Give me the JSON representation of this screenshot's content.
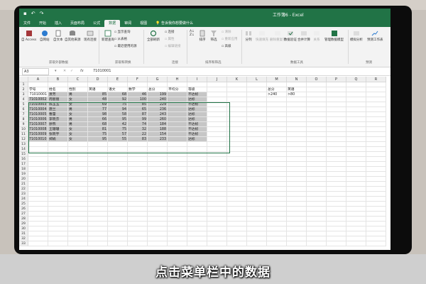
{
  "window": {
    "title": "工作簿6 - Excel"
  },
  "tabs": [
    "文件",
    "开始",
    "插入",
    "页面布局",
    "公式",
    "数据",
    "审阅",
    "视图"
  ],
  "active_tab": "数据",
  "tell_me": "告诉我你想要做什么",
  "ribbon": {
    "access": "自 Access",
    "website": "自网站",
    "text": "自文本",
    "other_sources": "自其他来源",
    "existing_connections": "现有连接",
    "group_external": "获取外部数据",
    "new_query": "新建查询",
    "show_queries": "显示查询",
    "from_table": "从表格",
    "recent_sources": "最近使用的源",
    "group_transform": "获取和转换",
    "refresh_all": "全部刷新",
    "connections": "连接",
    "properties": "属性",
    "edit_links": "编辑链接",
    "group_connections": "连接",
    "sort": "排序",
    "filter": "筛选",
    "clear": "清除",
    "reapply": "重新应用",
    "advanced": "高级",
    "group_sort_filter": "排序和筛选",
    "split": "分列",
    "flash_fill": "快速填充",
    "remove_duplicates": "删除重复项",
    "data_validation": "数据验证",
    "consolidate": "合并计算",
    "relationships": "关系",
    "manage_model": "管理数据模型",
    "group_data_tools": "数据工具",
    "what_if": "模拟分析",
    "forecast_sheet": "预测工作表",
    "group_forecast": "预测"
  },
  "formula_bar": {
    "name_box": "A3",
    "fx": "fx",
    "value": "71010001"
  },
  "columns": [
    "A",
    "B",
    "C",
    "D",
    "E",
    "F",
    "G",
    "H",
    "I",
    "J",
    "K",
    "L",
    "M",
    "N",
    "O",
    "P",
    "Q",
    "R"
  ],
  "headers": [
    "学号",
    "姓名",
    "性别",
    "英语",
    "语文",
    "数学",
    "总分",
    "平均分",
    "等级"
  ],
  "rows": [
    [
      "71010001",
      "萧芳",
      "男",
      "85",
      "68",
      "46",
      "199",
      "",
      "不达标"
    ],
    [
      "71010002",
      "周丽丽",
      "女",
      "48",
      "92",
      "100",
      "240",
      "",
      "达标"
    ],
    [
      "71010003",
      "陈玉玉",
      "女",
      "69",
      "75",
      "85",
      "229",
      "",
      "不达标"
    ],
    [
      "71010004",
      "唐兰",
      "男",
      "77",
      "94",
      "65",
      "236",
      "",
      "达标"
    ],
    [
      "71010005",
      "曹蕾",
      "女",
      "98",
      "58",
      "87",
      "243",
      "",
      "达标"
    ],
    [
      "71010006",
      "李晓芬",
      "男",
      "66",
      "95",
      "99",
      "260",
      "",
      "达标"
    ],
    [
      "71010007",
      "廖燕",
      "男",
      "68",
      "42",
      "74",
      "184",
      "",
      "不达标"
    ],
    [
      "71010008",
      "王珊珊",
      "女",
      "81",
      "75",
      "32",
      "188",
      "",
      "不达标"
    ],
    [
      "71010009",
      "张晓宇",
      "女",
      "75",
      "57",
      "22",
      "154",
      "",
      "不达标"
    ],
    [
      "71010010",
      "郑娟",
      "女",
      "95",
      "55",
      "83",
      "233",
      "",
      "达标"
    ]
  ],
  "criteria": {
    "h1": "总分",
    "h2": "英语",
    "v1": ">240",
    "v2": ">80"
  },
  "caption": "点击菜单栏中的数据"
}
